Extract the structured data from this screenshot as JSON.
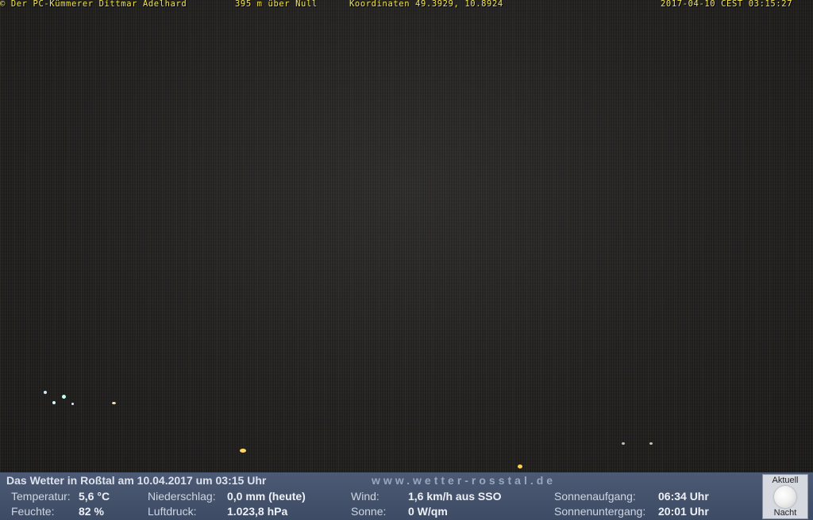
{
  "overlay": {
    "credit": "© Der PC-Kümmerer Dittmar Adelhard",
    "altitude": "395 m über Null",
    "coordinates": "Koordinaten 49.3929, 10.8924",
    "timestamp": "2017-04-10 CEST 03:15:27"
  },
  "weather": {
    "title": "Das Wetter in Roßtal am 10.04.2017 um 03:15 Uhr",
    "website": "www.wetter-rosstal.de",
    "temperature": {
      "label": "Temperatur:",
      "value": "5,6 °C"
    },
    "humidity": {
      "label": "Feuchte:",
      "value": "82 %"
    },
    "precipitation": {
      "label": "Niederschlag:",
      "value": "0,0 mm (heute)"
    },
    "pressure": {
      "label": "Luftdruck:",
      "value": "1.023,8 hPa"
    },
    "wind": {
      "label": "Wind:",
      "value": "1,6 km/h aus SSO"
    },
    "sun": {
      "label": "Sonne:",
      "value": "0 W/qm"
    },
    "sunrise": {
      "label": "Sonnenaufgang:",
      "value": "06:34 Uhr"
    },
    "sunset": {
      "label": "Sonnenuntergang:",
      "value": "20:01 Uhr"
    },
    "moon": {
      "top": "Aktuell",
      "bottom": "Nacht",
      "icon": "moon-icon"
    }
  },
  "colors": {
    "overlay_text": "#f4e64b",
    "bar_background": "#45526c"
  }
}
